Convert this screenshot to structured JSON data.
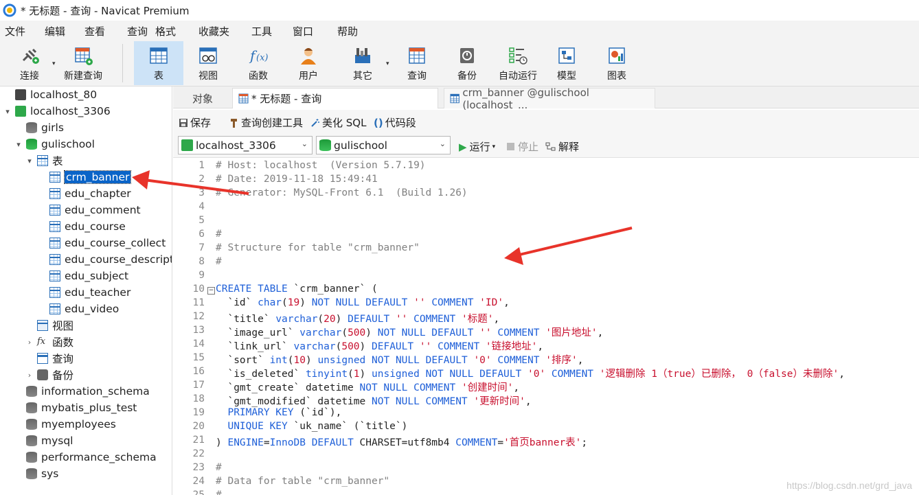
{
  "window": {
    "title": "* 无标题 - 查询 - Navicat Premium"
  },
  "menubar": [
    "文件",
    "编辑",
    "查看",
    "查询",
    "格式",
    "收藏夹",
    "工具",
    "窗口",
    "帮助"
  ],
  "toolbar": {
    "connect": "连接",
    "new_query": "新建查询",
    "table": "表",
    "view": "视图",
    "function": "函数",
    "user": "用户",
    "other": "其它",
    "query": "查询",
    "backup": "备份",
    "automation": "自动运行",
    "model": "模型",
    "chart": "图表"
  },
  "sidebar": {
    "conn1": "localhost_80",
    "conn2": "localhost_3306",
    "db_girls": "girls",
    "db_gulischool": "gulischool",
    "tables_label": "表",
    "tables": [
      "crm_banner",
      "edu_chapter",
      "edu_comment",
      "edu_course",
      "edu_course_collect",
      "edu_course_descripti",
      "edu_subject",
      "edu_teacher",
      "edu_video"
    ],
    "views_label": "视图",
    "functions_label": "函数",
    "queries_label": "查询",
    "backups_label": "备份",
    "other_dbs": [
      "information_schema",
      "mybatis_plus_test",
      "myemployees",
      "mysql",
      "performance_schema",
      "sys"
    ]
  },
  "tabs": {
    "objects": "对象",
    "query_tab": "* 无标题 - 查询",
    "table_tab": "crm_banner @gulischool (localhost_..."
  },
  "querybar": {
    "save": "保存",
    "builder": "查询创建工具",
    "beautify": "美化 SQL",
    "snippet": "代码段"
  },
  "connbar": {
    "connection": "localhost_3306",
    "database": "gulischool",
    "run": "运行",
    "stop": "停止",
    "explain": "解释"
  },
  "editor": {
    "lines": [
      "1",
      "2",
      "3",
      "4",
      "5",
      "6",
      "7",
      "8",
      "9",
      "10",
      "11",
      "12",
      "13",
      "14",
      "15",
      "16",
      "17",
      "18",
      "19",
      "20",
      "21",
      "22",
      "23",
      "24",
      "25"
    ]
  },
  "watermark": "https://blog.csdn.net/grd_java"
}
